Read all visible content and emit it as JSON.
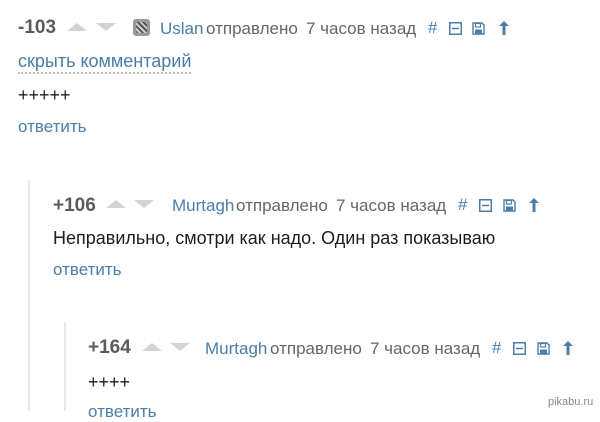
{
  "comments": [
    {
      "score": "-103",
      "author": "Uslan",
      "sent_label": "отправлено",
      "time": "7 часов назад",
      "hide_label": "скрыть комментарий",
      "text": "+++++",
      "reply_label": "ответить",
      "tools": {
        "hash": "#"
      }
    },
    {
      "score": "+106",
      "author": "Murtagh",
      "sent_label": "отправлено",
      "time": "7 часов назад",
      "text": "Неправильно, смотри как надо. Один раз показываю",
      "reply_label": "ответить",
      "tools": {
        "hash": "#"
      }
    },
    {
      "score": "+164",
      "author": "Murtagh",
      "sent_label": "отправлено",
      "time": "7 часов назад",
      "text": "++++",
      "reply_label": "ответить",
      "tools": {
        "hash": "#"
      }
    }
  ],
  "watermark": "pikabu.ru",
  "colors": {
    "link": "#4a7ea8",
    "score": "#5b5b5b",
    "vote_arrow": "#d3d3d3"
  },
  "icons": [
    "upvote-icon",
    "downvote-icon",
    "avatar-icon",
    "collapse-icon",
    "save-icon",
    "parent-arrow-icon"
  ]
}
